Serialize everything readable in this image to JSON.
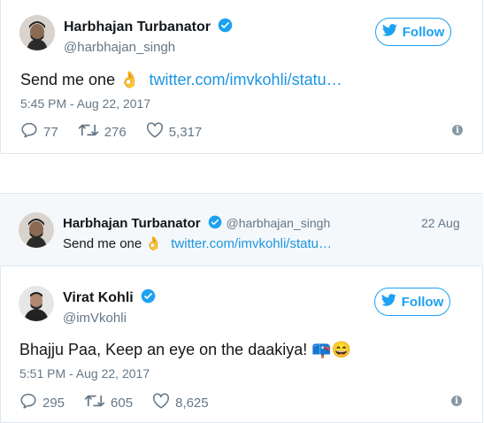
{
  "tweet1": {
    "name": "Harbhajan Turbanator",
    "handle": "@harbhajan_singh",
    "follow_label": "Follow",
    "text": "Send me one",
    "emoji": "👌",
    "link": "twitter.com/imvkohli/statu…",
    "timestamp": "5:45 PM - Aug 22, 2017",
    "replies": "77",
    "retweets": "276",
    "likes": "5,317"
  },
  "quoted": {
    "name": "Harbhajan Turbanator",
    "handle": "@harbhajan_singh",
    "date": "22 Aug",
    "text": "Send me one",
    "emoji": "👌",
    "link": "twitter.com/imvkohli/statu…"
  },
  "tweet2": {
    "name": "Virat Kohli",
    "handle": "@imVkohli",
    "follow_label": "Follow",
    "text": "Bhajju Paa, Keep an eye on the daakiya!",
    "emoji": "📪😄",
    "timestamp": "5:51 PM - Aug 22, 2017",
    "replies": "295",
    "retweets": "605",
    "likes": "8,625"
  },
  "colors": {
    "accent": "#1da1f2",
    "link": "#1b95e0",
    "muted": "#657786",
    "quote_bg": "#f5f8fa"
  },
  "icons": [
    "verified-badge-icon",
    "twitter-bird-icon",
    "reply-icon",
    "retweet-icon",
    "like-icon",
    "info-icon"
  ]
}
